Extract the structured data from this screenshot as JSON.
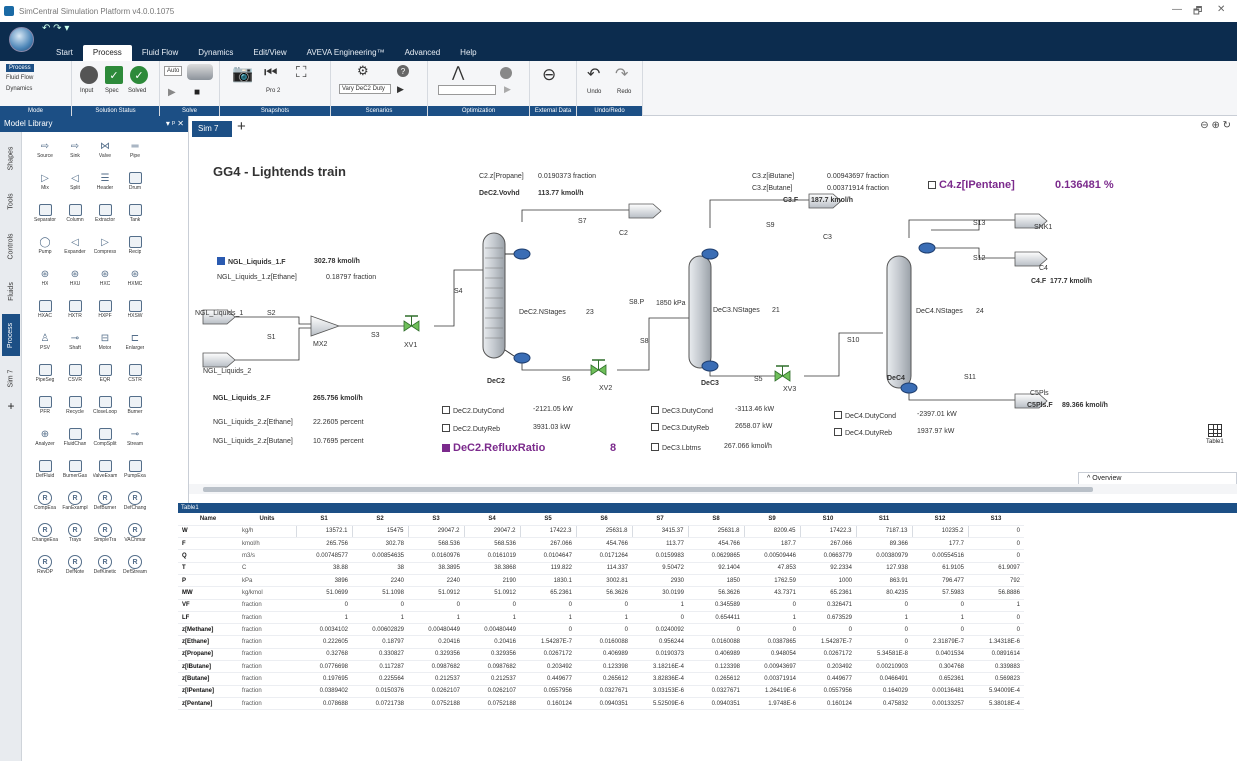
{
  "window": {
    "title": "SimCentral Simulation Platform v4.0.0.1075",
    "controls": [
      "—",
      "🗗",
      "✕"
    ]
  },
  "ribbon": {
    "tabs": [
      "Start",
      "Process",
      "Fluid Flow",
      "Dynamics",
      "Edit/View",
      "AVEVA Engineering™",
      "Advanced",
      "Help"
    ],
    "active_tab": "Process",
    "mode": {
      "items": [
        "Process",
        "Fluid Flow",
        "Dynamics"
      ],
      "label": "Mode"
    },
    "solution_status": {
      "input": "Input",
      "spec": "Spec",
      "solved": "Solved",
      "label": "Solution Status"
    },
    "solve": {
      "auto": "Auto",
      "label": "Solve"
    },
    "snapshots": {
      "name": "Pro 2",
      "label": "Snapshots"
    },
    "scenarios": {
      "selected": "Vary DeC2 Duty",
      "label": "Scenarios"
    },
    "optimization": {
      "label": "Optimization"
    },
    "external_data": {
      "label": "External Data"
    },
    "undo_redo": {
      "undo": "Undo",
      "redo": "Redo",
      "label": "Undo/Redo"
    }
  },
  "model_library": {
    "title": "Model Library",
    "pin": "▾ ᵖ ✕",
    "side_tabs": [
      "Shapes",
      "Tools",
      "Controls",
      "Fluids",
      "Process",
      "Sim 7"
    ],
    "active_side_tab": "Process",
    "items": [
      {
        "name": "Source",
        "icon": "source-icon"
      },
      {
        "name": "Sink",
        "icon": "sink-icon"
      },
      {
        "name": "Valve",
        "icon": "valve-icon"
      },
      {
        "name": "Pipe",
        "icon": "pipe-icon"
      },
      {
        "name": "",
        "icon": ""
      },
      {
        "name": "Mix",
        "icon": "mixer-icon"
      },
      {
        "name": "Split",
        "icon": "splitter-icon"
      },
      {
        "name": "Header",
        "icon": "header-icon"
      },
      {
        "name": "Drum",
        "icon": "drum-icon"
      },
      {
        "name": "",
        "icon": ""
      },
      {
        "name": "Separator",
        "icon": "separator-icon"
      },
      {
        "name": "Column",
        "icon": "column-icon"
      },
      {
        "name": "Extractor",
        "icon": "extractor-icon"
      },
      {
        "name": "Tank",
        "icon": "tank-icon"
      },
      {
        "name": "",
        "icon": ""
      },
      {
        "name": "Pump",
        "icon": "pump-icon"
      },
      {
        "name": "Expander",
        "icon": "expander-icon"
      },
      {
        "name": "Compress",
        "icon": "compressor-icon"
      },
      {
        "name": "Recip",
        "icon": "recip-icon"
      },
      {
        "name": "",
        "icon": ""
      },
      {
        "name": "HX",
        "icon": "hx-icon"
      },
      {
        "name": "HXU",
        "icon": "hxu-icon"
      },
      {
        "name": "HXC",
        "icon": "hxc-icon"
      },
      {
        "name": "HXMC",
        "icon": "hxmc-icon"
      },
      {
        "name": "",
        "icon": ""
      },
      {
        "name": "HXAC",
        "icon": "hxac-icon"
      },
      {
        "name": "HXTR",
        "icon": "hxtr-icon"
      },
      {
        "name": "HXPF",
        "icon": "hxpf-icon"
      },
      {
        "name": "HXSW",
        "icon": "hxsw-icon"
      },
      {
        "name": "",
        "icon": ""
      },
      {
        "name": "PSV",
        "icon": "psv-icon"
      },
      {
        "name": "Shaft",
        "icon": "shaft-icon"
      },
      {
        "name": "Motor",
        "icon": "motor-icon"
      },
      {
        "name": "Enlarger",
        "icon": "enlarger-icon"
      },
      {
        "name": "",
        "icon": ""
      },
      {
        "name": "PipeSeg",
        "icon": "pipeseg-icon"
      },
      {
        "name": "CSVR",
        "icon": "csvr-icon"
      },
      {
        "name": "EQR",
        "icon": "eqr-icon"
      },
      {
        "name": "CSTR",
        "icon": "cstr-icon"
      },
      {
        "name": "",
        "icon": ""
      },
      {
        "name": "PFR",
        "icon": "pfr-icon"
      },
      {
        "name": "Recycle",
        "icon": "recycle-icon"
      },
      {
        "name": "CloseLoop",
        "icon": "closeloop-icon"
      },
      {
        "name": "Burner",
        "icon": "burner-icon"
      },
      {
        "name": "",
        "icon": ""
      },
      {
        "name": "Analyzer",
        "icon": "analyzer-icon"
      },
      {
        "name": "FluidChan",
        "icon": "fluidchan-icon"
      },
      {
        "name": "CompSplit",
        "icon": "compsplit-icon"
      },
      {
        "name": "Stream",
        "icon": "stream-icon"
      },
      {
        "name": "",
        "icon": ""
      },
      {
        "name": "DefFluid",
        "icon": "deffluid-icon"
      },
      {
        "name": "BurnerGas",
        "icon": "burnergas-icon"
      },
      {
        "name": "ValveExam",
        "icon": "valveexam-icon"
      },
      {
        "name": "PumpExa",
        "icon": "pumpexa-icon"
      },
      {
        "name": "",
        "icon": ""
      },
      {
        "name": "CompExa",
        "icon": "compexa-icon"
      },
      {
        "name": "FanExampl",
        "icon": "fanexampl-icon"
      },
      {
        "name": "DefBurner",
        "icon": "defburner-icon"
      },
      {
        "name": "DefChang",
        "icon": "defchang-icon"
      },
      {
        "name": "",
        "icon": ""
      },
      {
        "name": "ChangeExa",
        "icon": "changeexa-icon"
      },
      {
        "name": "Trays",
        "icon": "trays-icon"
      },
      {
        "name": "SimpleTra",
        "icon": "simpletra-icon"
      },
      {
        "name": "VAChmar",
        "icon": "vachmar-icon"
      },
      {
        "name": "",
        "icon": ""
      },
      {
        "name": "RevDP",
        "icon": "revdp-icon"
      },
      {
        "name": "DefNote",
        "icon": "defnote-icon"
      },
      {
        "name": "DefKinetic",
        "icon": "defkinetic-icon"
      },
      {
        "name": "DefStream",
        "icon": "defstream-icon"
      }
    ]
  },
  "document": {
    "tab": "Sim 7",
    "add": "+",
    "zoom": "⊖ ⊕ ↻"
  },
  "flowsheet": {
    "title": "GG4 - Lightends train",
    "ngl1": {
      "label": "NGL_Liquids_1.F",
      "flow": "302.78 kmol/h",
      "ethane_label": "NGL_Liquids_1.z[Ethane]",
      "ethane_val": "0.18797 fraction",
      "stream": "NGL_Liquids_1"
    },
    "ngl2": {
      "label": "NGL_Liquids_2.F",
      "flow": "265.756 kmol/h",
      "ethane_label": "NGL_Liquids_2.z[Ethane]",
      "ethane_val": "22.2605 percent",
      "butane_label": "NGL_Liquids_2.z[Butane]",
      "butane_val": "10.7695 percent",
      "stream": "NGL_Liquids_2"
    },
    "streams": [
      "S1",
      "S2",
      "S3",
      "S4",
      "S5",
      "S6",
      "S7",
      "S8",
      "S9",
      "S10",
      "S11",
      "S12",
      "S13",
      "S8.P",
      "MX2",
      "XV1",
      "XV2",
      "XV3",
      "C2",
      "C3",
      "C4",
      "SNK1",
      "C5Pls"
    ],
    "dec2": {
      "name": "DeC2",
      "nstages_label": "DeC2.NStages",
      "nstages": "23",
      "propane_label": "C2.z[Propane]",
      "propane_val": "0.0190373 fraction",
      "vovhd_label": "DeC2.Vovhd",
      "vovhd_val": "113.77 kmol/h",
      "duty_cond_label": "DeC2.DutyCond",
      "duty_cond_val": "-2121.05 kW",
      "duty_reb_label": "DeC2.DutyReb",
      "duty_reb_val": "3931.03 kW",
      "reflux_label": "DeC2.RefluxRatio",
      "reflux_val": "8"
    },
    "dec3": {
      "name": "DeC3",
      "nstages_label": "DeC3.NStages",
      "nstages": "21",
      "pressure": "1850 kPa",
      "ibutane_label": "C3.z[iButane]",
      "ibutane_val": "0.00943697 fraction",
      "butane_label": "C3.z[Butane]",
      "butane_val": "0.00371914 fraction",
      "c3f_label": "C3.F",
      "c3f_val": "187.7 kmol/h",
      "duty_cond_label": "DeC3.DutyCond",
      "duty_cond_val": "-3113.46 kW",
      "duty_reb_label": "DeC3.DutyReb",
      "duty_reb_val": "2658.07 kW",
      "lbtms_label": "DeC3.Lbtms",
      "lbtms_val": "267.066 kmol/h"
    },
    "dec4": {
      "name": "DeC4",
      "nstages_label": "DeC4.NStages",
      "nstages": "24",
      "ipentane_label": "C4.z[IPentane]",
      "ipentane_val": "0.136481 %",
      "c4f_label": "C4.F",
      "c4f_val": "177.7 kmol/h",
      "c5f_label": "C5Pls.F",
      "c5f_val": "89.366 kmol/h",
      "duty_cond_label": "DeC4.DutyCond",
      "duty_cond_val": "-2397.01 kW",
      "duty_reb_label": "DeC4.DutyReb",
      "duty_reb_val": "1937.97 kW"
    }
  },
  "overview": "^ Overview",
  "table_icon_label": "Table1",
  "table": {
    "title": "Table1",
    "columns": [
      "Name",
      "Units",
      "S1",
      "S2",
      "S3",
      "S4",
      "S5",
      "S6",
      "S7",
      "S8",
      "S9",
      "S10",
      "S11",
      "S12",
      "S13"
    ],
    "rows": [
      [
        "W",
        "kg/h",
        "13572.1",
        "15475",
        "29047.2",
        "29047.2",
        "17422.3",
        "25631.8",
        "3415.37",
        "25631.8",
        "8209.45",
        "17422.3",
        "7187.13",
        "10235.2",
        "0"
      ],
      [
        "F",
        "kmol/h",
        "265.756",
        "302.78",
        "568.536",
        "568.536",
        "267.066",
        "454.766",
        "113.77",
        "454.766",
        "187.7",
        "267.066",
        "89.366",
        "177.7",
        "0"
      ],
      [
        "Q",
        "m3/s",
        "0.00748577",
        "0.00854635",
        "0.0160976",
        "0.0161019",
        "0.0104647",
        "0.0171264",
        "0.0159983",
        "0.0629865",
        "0.00509446",
        "0.0663779",
        "0.00380979",
        "0.00554516",
        "0"
      ],
      [
        "T",
        "C",
        "38.88",
        "38",
        "38.3895",
        "38.3868",
        "119.822",
        "114.337",
        "9.50472",
        "92.1404",
        "47.853",
        "92.2334",
        "127.938",
        "61.9105",
        "61.9097"
      ],
      [
        "P",
        "kPa",
        "3896",
        "2240",
        "2240",
        "2190",
        "1830.1",
        "3002.81",
        "2930",
        "1850",
        "1762.59",
        "1000",
        "863.91",
        "796.477",
        "792"
      ],
      [
        "MW",
        "kg/kmol",
        "51.0699",
        "51.1098",
        "51.0912",
        "51.0912",
        "65.2361",
        "56.3626",
        "30.0199",
        "56.3626",
        "43.7371",
        "65.2361",
        "80.4235",
        "57.5983",
        "56.8886"
      ],
      [
        "VF",
        "fraction",
        "0",
        "0",
        "0",
        "0",
        "0",
        "0",
        "1",
        "0.345589",
        "0",
        "0.326471",
        "0",
        "0",
        "1"
      ],
      [
        "LF",
        "fraction",
        "1",
        "1",
        "1",
        "1",
        "1",
        "1",
        "0",
        "0.654411",
        "1",
        "0.673529",
        "1",
        "1",
        "0"
      ],
      [
        "z[Methane]",
        "fraction",
        "0.0034102",
        "0.00602829",
        "0.00480449",
        "0.00480449",
        "0",
        "0",
        "0.0240092",
        "0",
        "0",
        "0",
        "0",
        "0",
        "0"
      ],
      [
        "z[Ethane]",
        "fraction",
        "0.222605",
        "0.18797",
        "0.20416",
        "0.20416",
        "1.54287E-7",
        "0.0160088",
        "0.956244",
        "0.0160088",
        "0.0387865",
        "1.54287E-7",
        "0",
        "2.31879E-7",
        "1.34318E-6"
      ],
      [
        "z[Propane]",
        "fraction",
        "0.32768",
        "0.330827",
        "0.329356",
        "0.329356",
        "0.0267172",
        "0.406989",
        "0.0190373",
        "0.406989",
        "0.948054",
        "0.0267172",
        "5.34581E-8",
        "0.0401534",
        "0.0891614"
      ],
      [
        "z[IButane]",
        "fraction",
        "0.0776698",
        "0.117287",
        "0.0987682",
        "0.0987682",
        "0.203492",
        "0.123398",
        "3.18216E-4",
        "0.123398",
        "0.00943697",
        "0.203492",
        "0.00210903",
        "0.304768",
        "0.339883"
      ],
      [
        "z[Butane]",
        "fraction",
        "0.197695",
        "0.225564",
        "0.212537",
        "0.212537",
        "0.449677",
        "0.265612",
        "3.82836E-4",
        "0.265612",
        "0.00371914",
        "0.449677",
        "0.0466491",
        "0.652361",
        "0.569823"
      ],
      [
        "z[IPentane]",
        "fraction",
        "0.0389402",
        "0.0150376",
        "0.0262107",
        "0.0262107",
        "0.0557956",
        "0.0327671",
        "3.03153E-6",
        "0.0327671",
        "1.26419E-6",
        "0.0557956",
        "0.164029",
        "0.00136481",
        "5.94009E-4"
      ],
      [
        "z[Pentane]",
        "fraction",
        "0.078688",
        "0.0721738",
        "0.0752188",
        "0.0752188",
        "0.160124",
        "0.0940351",
        "5.52509E-6",
        "0.0940351",
        "1.9748E-6",
        "0.160124",
        "0.475832",
        "0.00133257",
        "5.38018E-4"
      ]
    ]
  },
  "colors": {
    "ribbon": "#0c2c4e",
    "accent": "#1c4f85",
    "column": "#c8ccd2",
    "highlight": "#7b2a8c"
  }
}
